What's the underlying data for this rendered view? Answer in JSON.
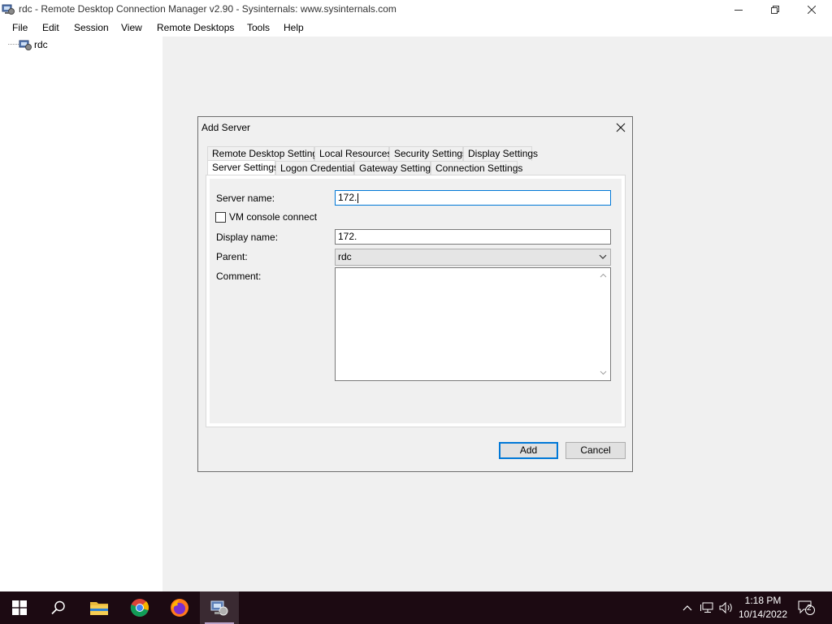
{
  "window": {
    "title": "rdc - Remote Desktop Connection Manager v2.90 - Sysinternals: www.sysinternals.com",
    "icon": "rdcman-app-icon"
  },
  "menu": [
    "File",
    "Edit",
    "Session",
    "View",
    "Remote Desktops",
    "Tools",
    "Help"
  ],
  "tree": {
    "root_label": "rdc"
  },
  "dialog": {
    "title": "Add Server",
    "tabs_row1": [
      "Remote Desktop Settings",
      "Local Resources",
      "Security Settings",
      "Display Settings"
    ],
    "tabs_row2": [
      "Server Settings",
      "Logon Credentials",
      "Gateway Settings",
      "Connection Settings"
    ],
    "active_tab": "Server Settings",
    "fields": {
      "server_name_label": "Server name:",
      "server_name_value": "172.",
      "vm_console_label": "VM console connect",
      "vm_console_checked": false,
      "display_name_label": "Display name:",
      "display_name_value": "172.",
      "parent_label": "Parent:",
      "parent_value": "rdc",
      "comment_label": "Comment:",
      "comment_value": ""
    },
    "buttons": {
      "add": "Add",
      "cancel": "Cancel"
    }
  },
  "taskbar": {
    "items": [
      "start-icon",
      "search-icon",
      "file-explorer-icon",
      "chrome-icon",
      "firefox-icon",
      "rdcman-icon"
    ],
    "active_item": "rdcman-icon",
    "clock_time": "1:18 PM",
    "clock_date": "10/14/2022",
    "notification_count": "2"
  },
  "colors": {
    "taskbar_bg": "#1c0a12",
    "accent": "#0078d7",
    "workarea": "#f0f0f0"
  }
}
